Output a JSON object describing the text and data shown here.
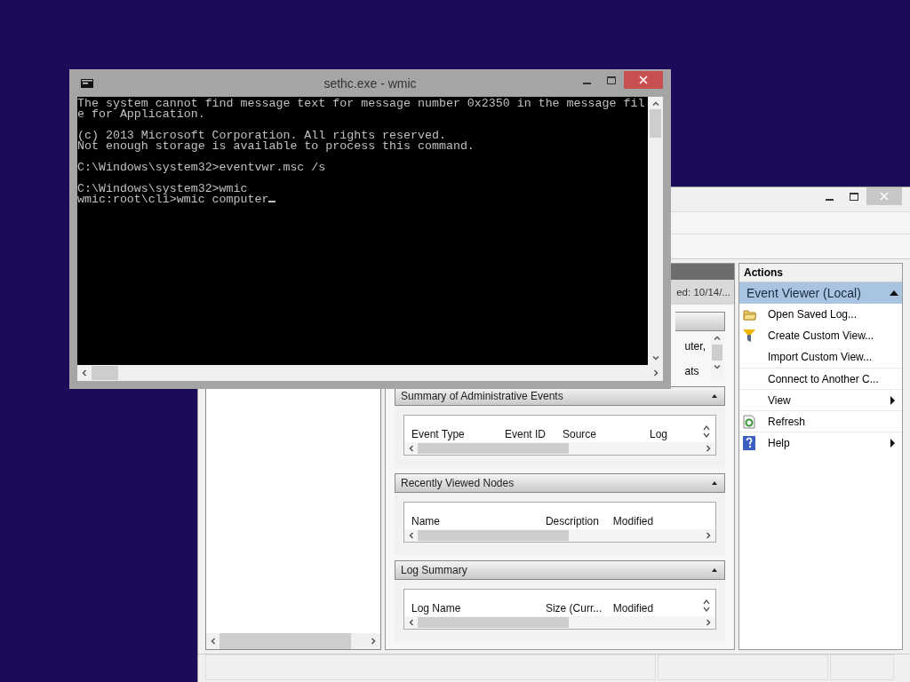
{
  "event_viewer": {
    "center": {
      "banner_text": "ed: 10/14/...",
      "overview_texts": [
        "uter,",
        "ats"
      ],
      "panels": [
        {
          "title": "Summary of Administrative Events",
          "columns": [
            "Event Type",
            "Event ID",
            "Source",
            "Log"
          ],
          "vertical_scroll": true
        },
        {
          "title": "Recently Viewed Nodes",
          "columns": [
            "Name",
            "Description",
            "Modified"
          ],
          "vertical_scroll": false
        },
        {
          "title": "Log Summary",
          "columns": [
            "Log Name",
            "Size (Curr...",
            "Modified"
          ],
          "vertical_scroll": true
        }
      ]
    },
    "actions": {
      "title": "Actions",
      "section": "Event Viewer (Local)",
      "items": [
        {
          "label": "Open Saved Log...",
          "kind": "folder",
          "submenu": false
        },
        {
          "label": "Create Custom View...",
          "kind": "funnel",
          "submenu": false
        },
        {
          "label": "Import Custom View...",
          "kind": "plain",
          "submenu": false
        },
        {
          "label": "Connect to Another C...",
          "kind": "plain",
          "submenu": false
        },
        {
          "label": "View",
          "kind": "plain",
          "submenu": true
        },
        {
          "label": "Refresh",
          "kind": "page",
          "submenu": false
        },
        {
          "label": "Help",
          "kind": "help",
          "submenu": true
        }
      ]
    }
  },
  "console": {
    "title": "sethc.exe - wmic",
    "paragraphs": [
      [
        "The system cannot find message text for message number 0x2350 in the message fil",
        "e for Application."
      ],
      [
        "(c) 2013 Microsoft Corporation. All rights reserved.",
        "Not enough storage is available to process this command."
      ],
      [
        "C:\\Windows\\system32>eventvwr.msc /s"
      ],
      [
        "C:\\Windows\\system32>wmic",
        "wmic:root\\cli>wmic computer"
      ]
    ],
    "cursor": true
  }
}
